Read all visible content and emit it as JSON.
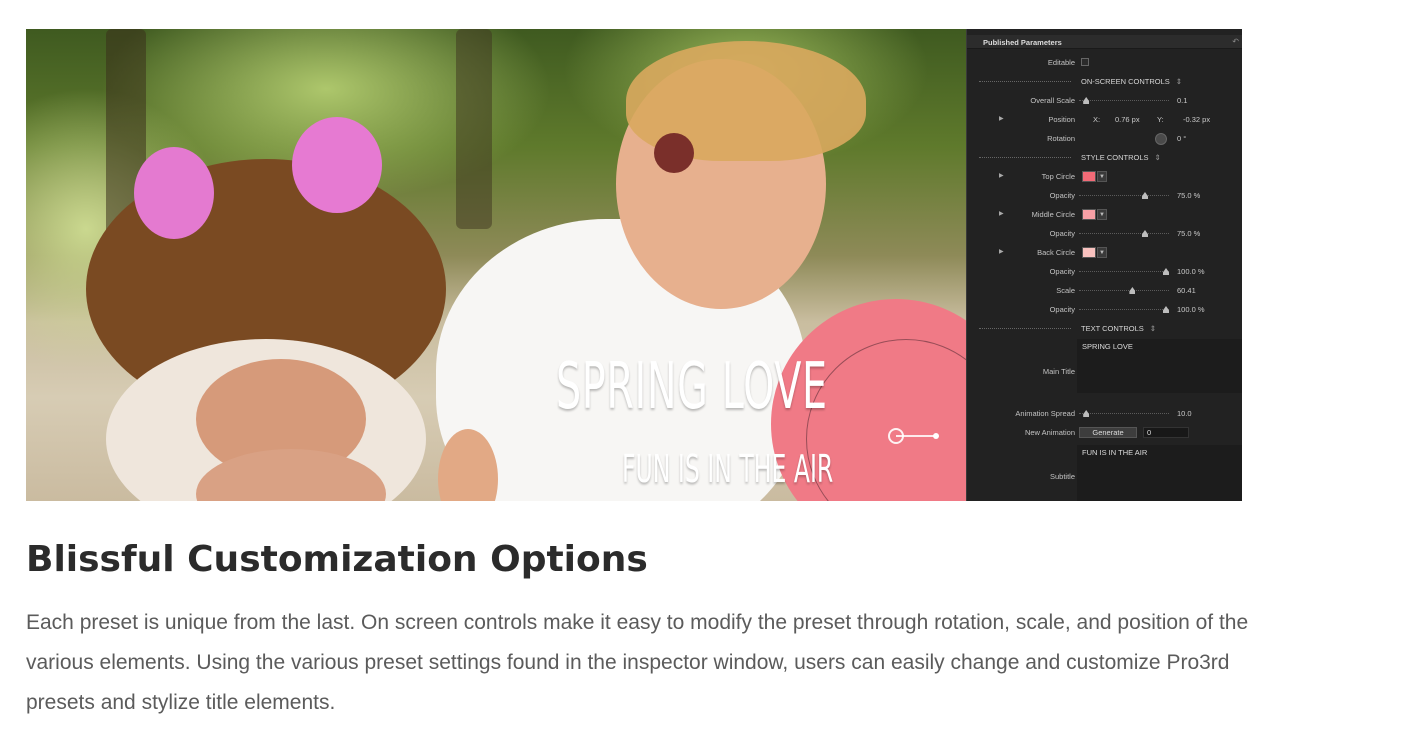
{
  "hero": {
    "overlay": {
      "main_title": "SPRING LOVE",
      "subtitle": "FUN IS IN THE AIR"
    },
    "inspector": {
      "header": "Published Parameters",
      "editable_label": "Editable",
      "onscreen_section": "ON-SCREEN CONTROLS",
      "overall_scale": {
        "label": "Overall Scale",
        "value": "0.1",
        "level": 0.05
      },
      "position": {
        "label": "Position",
        "x_label": "X:",
        "x_value": "0.76 px",
        "y_label": "Y:",
        "y_value": "-0.32 px"
      },
      "rotation": {
        "label": "Rotation",
        "value": "0 °"
      },
      "style_section": "STYLE CONTROLS",
      "top_circle": {
        "label": "Top Circle",
        "color": "#f26b77"
      },
      "top_opacity": {
        "label": "Opacity",
        "value": "75.0 %",
        "level": 0.75
      },
      "middle_circle": {
        "label": "Middle Circle",
        "color": "#f7a0a6"
      },
      "middle_opacity": {
        "label": "Opacity",
        "value": "75.0 %",
        "level": 0.75
      },
      "back_circle": {
        "label": "Back Circle",
        "color": "#f9c2bf"
      },
      "back_opacity": {
        "label": "Opacity",
        "value": "100.0 %",
        "level": 1.0
      },
      "scale": {
        "label": "Scale",
        "value": "60.41",
        "level": 0.6
      },
      "opacity_extra": {
        "label": "Opacity",
        "value": "100.0 %",
        "level": 1.0
      },
      "text_section": "TEXT CONTROLS",
      "main_title": {
        "label": "Main Title",
        "value": "SPRING LOVE"
      },
      "animation_spread": {
        "label": "Animation Spread",
        "value": "10.0",
        "level": 0.05
      },
      "new_animation": {
        "label": "New Animation",
        "button": "Generate",
        "value": "0"
      },
      "subtitle": {
        "label": "Subtitle",
        "value": "FUN IS IN THE AIR"
      }
    }
  },
  "article": {
    "heading": "Blissful Customization Options",
    "body": "Each preset is unique from the last. On screen controls make it easy to modify the preset through rotation, scale, and position of the various elements. Using the various preset settings found in the inspector window, users can easily change and customize Pro3rd presets and stylize title elements."
  }
}
